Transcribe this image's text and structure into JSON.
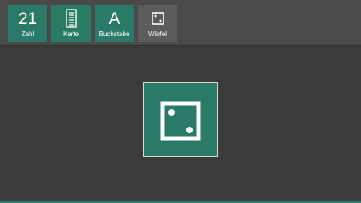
{
  "toolbar": {
    "tiles": [
      {
        "big": "21",
        "label": "Zahl",
        "active": true,
        "icon": "number"
      },
      {
        "big": "",
        "label": "Karte",
        "active": true,
        "icon": "card-icon"
      },
      {
        "big": "A",
        "label": "Buchstabe",
        "active": true,
        "icon": "letter"
      },
      {
        "big": "",
        "label": "Würfel",
        "active": false,
        "icon": "dice-icon"
      }
    ]
  },
  "display": {
    "mode": "Würfel",
    "dice_value": 2,
    "icon": "dice-two-icon"
  },
  "colors": {
    "accent": "#2a7a68",
    "background": "#3b3b3b",
    "toolbar": "#4a4a4a",
    "inactive_tile": "#5c5c5c"
  }
}
